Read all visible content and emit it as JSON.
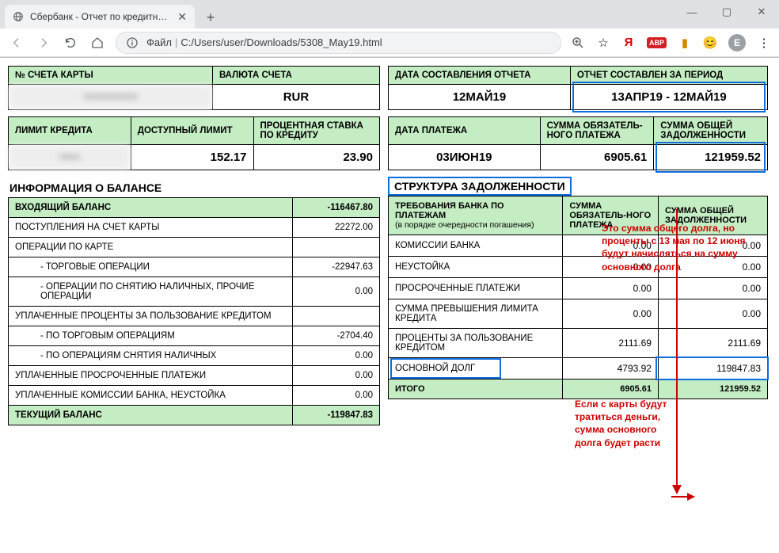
{
  "browser": {
    "tab_title": "Сбербанк - Отчет по кредитно…",
    "file_label": "Файл",
    "url": "C:/Users/user/Downloads/5308_May19.html",
    "avatar_letter": "E"
  },
  "top_left": {
    "h_card": "№ СЧЕТА КАРТЫ",
    "h_currency": "ВАЛЮТА СЧЕТА",
    "v_card": "•••••••••••••",
    "v_currency": "RUR"
  },
  "top_right": {
    "h_date": "ДАТА СОСТАВЛЕНИЯ ОТЧЕТА",
    "h_period": "ОТЧЕТ СОСТАВЛЕН ЗА ПЕРИОД",
    "v_date": "12МАЙ19",
    "v_period": "13АПР19 - 12МАЙ19"
  },
  "row2_left": {
    "h_limit": "ЛИМИТ КРЕДИТА",
    "h_avail": "ДОСТУПНЫЙ ЛИМИТ",
    "h_rate": "ПРОЦЕНТНАЯ СТАВКА ПО КРЕДИТУ",
    "v_limit": "•••••",
    "v_avail": "152.17",
    "v_rate": "23.90"
  },
  "row2_right": {
    "h_paydate": "ДАТА ПЛАТЕЖА",
    "h_minpay": "СУММА ОБЯЗАТЕЛЬ-НОГО ПЛАТЕЖА",
    "h_total": "СУММА ОБЩЕЙ ЗАДОЛЖЕННОСТИ",
    "v_paydate": "03ИЮН19",
    "v_minpay": "6905.61",
    "v_total": "121959.52"
  },
  "balance": {
    "title": "ИНФОРМАЦИЯ О БАЛАНСЕ",
    "r_in_label": "ВХОДЯЩИЙ БАЛАНС",
    "r_in_val": "-116467.80",
    "r1_label": "ПОСТУПЛЕНИЯ НА СЧЕТ КАРТЫ",
    "r1_val": "22272.00",
    "r2_label": "ОПЕРАЦИИ ПО КАРТЕ",
    "r2_val": "",
    "r2a_label": "- ТОРГОВЫЕ ОПЕРАЦИИ",
    "r2a_val": "-22947.63",
    "r2b_label": "- ОПЕРАЦИИ ПО СНЯТИЮ НАЛИЧНЫХ, ПРОЧИЕ ОПЕРАЦИИ",
    "r2b_val": "0.00",
    "r3_label": "УПЛАЧЕННЫЕ ПРОЦЕНТЫ ЗА ПОЛЬЗОВАНИЕ КРЕДИТОМ",
    "r3_val": "",
    "r3a_label": "- ПО ТОРГОВЫМ ОПЕРАЦИЯМ",
    "r3a_val": "-2704.40",
    "r3b_label": "- ПО ОПЕРАЦИЯМ СНЯТИЯ НАЛИЧНЫХ",
    "r3b_val": "0.00",
    "r4_label": "УПЛАЧЕННЫЕ ПРОСРОЧЕННЫЕ ПЛАТЕЖИ",
    "r4_val": "0.00",
    "r5_label": "УПЛАЧЕННЫЕ КОМИССИИ БАНКА, НЕУСТОЙКА",
    "r5_val": "0.00",
    "r_out_label": "ТЕКУЩИЙ БАЛАНС",
    "r_out_val": "-119847.83"
  },
  "debt": {
    "title": "СТРУКТУРА ЗАДОЛЖЕННОСТИ",
    "h1": "ТРЕБОВАНИЯ БАНКА ПО ПЛАТЕЖАМ",
    "h1_sub": "(в порядке очередности погашения)",
    "h2": "СУММА ОБЯЗАТЕЛЬ-НОГО ПЛАТЕЖА",
    "h3": "СУММА ОБЩЕЙ ЗАДОЛЖЕННОСТИ",
    "r1_l": "КОМИССИИ БАНКА",
    "r1_a": "0.00",
    "r1_b": "0.00",
    "r2_l": "НЕУСТОЙКА",
    "r2_a": "0.00",
    "r2_b": "0.00",
    "r3_l": "ПРОСРОЧЕННЫЕ ПЛАТЕЖИ",
    "r3_a": "0.00",
    "r3_b": "0.00",
    "r4_l": "СУММА ПРЕВЫШЕНИЯ ЛИМИТА КРЕДИТА",
    "r4_a": "0.00",
    "r4_b": "0.00",
    "r5_l": "ПРОЦЕНТЫ ЗА ПОЛЬЗОВАНИЕ КРЕДИТОМ",
    "r5_a": "2111.69",
    "r5_b": "2111.69",
    "r6_l": "ОСНОВНОЙ ДОЛГ",
    "r6_a": "4793.92",
    "r6_b": "119847.83",
    "rt_l": "ИТОГО",
    "rt_a": "6905.61",
    "rt_b": "121959.52"
  },
  "annotations": {
    "note1": "Это сумма общего долга, но проценты с 13 мая по 12 июня будут начисляться на сумму основного долга",
    "note2": "Если с карты будут тратиться деньги, сумма основного долга будет расти"
  }
}
